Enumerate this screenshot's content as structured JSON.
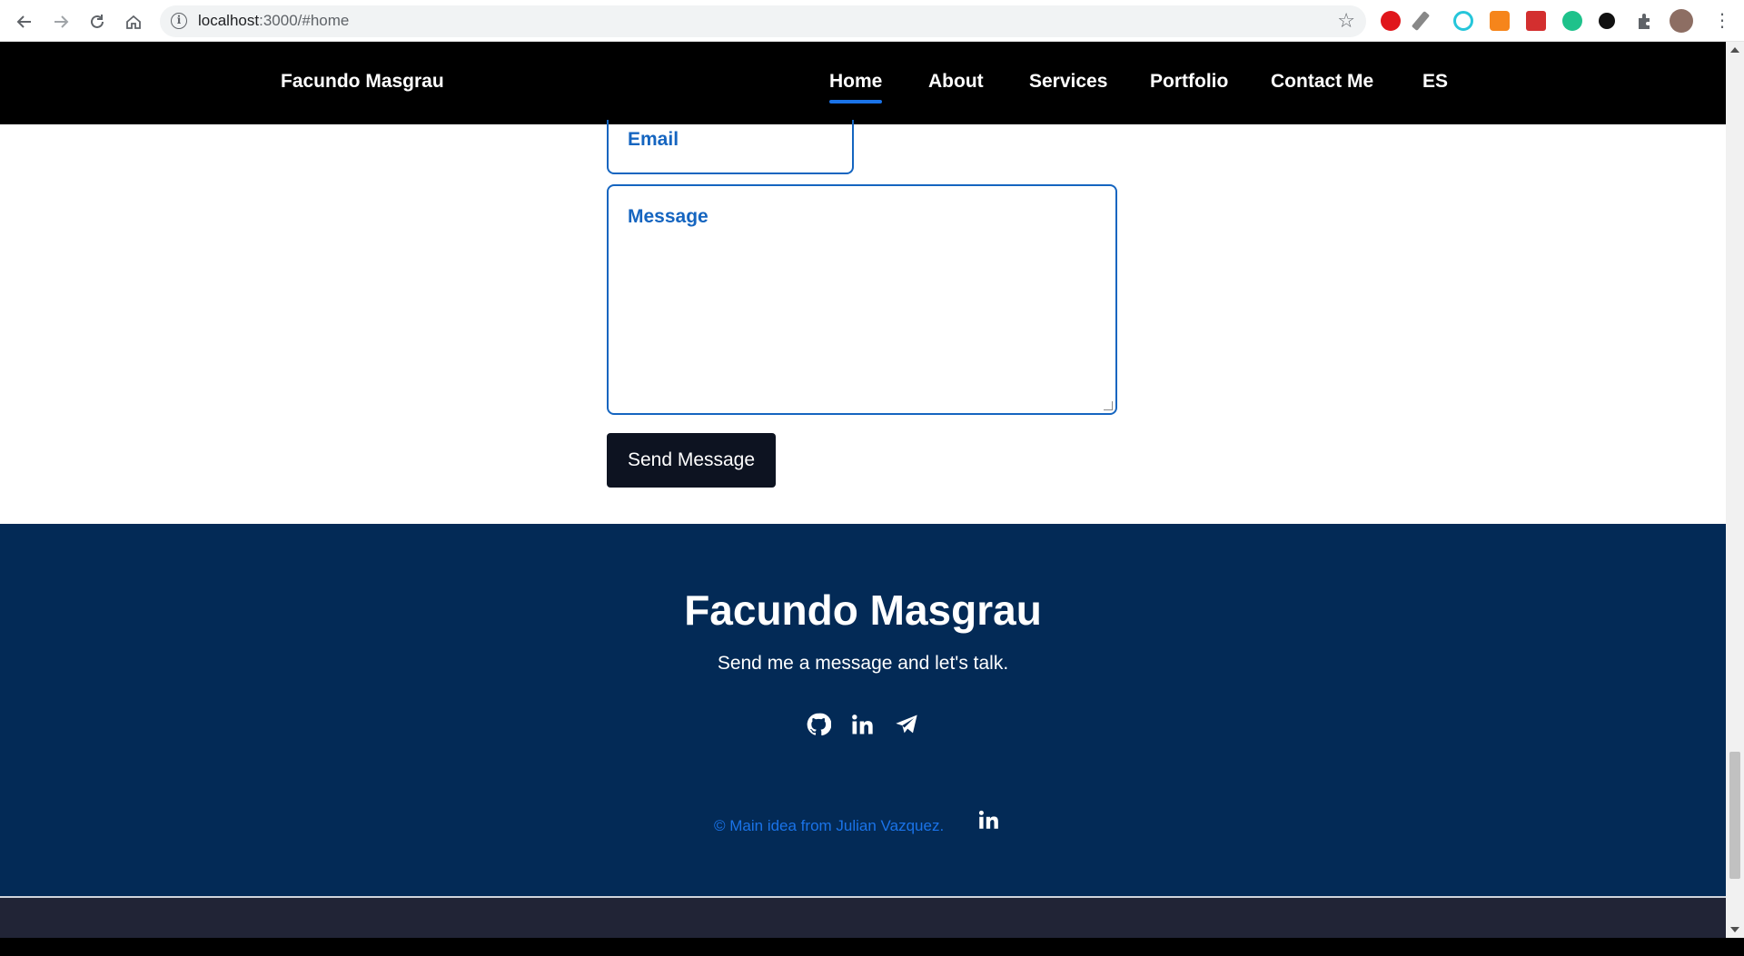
{
  "browser": {
    "url_host": "localhost",
    "url_path": ":3000/#home"
  },
  "nav": {
    "brand": "Facundo Masgrau",
    "items": [
      {
        "label": "Home",
        "active": true
      },
      {
        "label": "About"
      },
      {
        "label": "Services"
      },
      {
        "label": "Portfolio"
      },
      {
        "label": "Contact Me"
      },
      {
        "label": "ES"
      }
    ]
  },
  "form": {
    "email_placeholder": "Email",
    "message_placeholder": "Message",
    "send_label": "Send Message"
  },
  "footer": {
    "title": "Facundo Masgrau",
    "subtitle": "Send me a message and let's talk.",
    "social_icons": [
      "github-icon",
      "linkedin-icon",
      "telegram-icon"
    ],
    "credit": "© Main idea from Julian Vazquez."
  },
  "colors": {
    "nav_bg": "#000000",
    "accent": "#1565c0",
    "footer_bg": "#032a56",
    "button_bg": "#0d1321"
  }
}
